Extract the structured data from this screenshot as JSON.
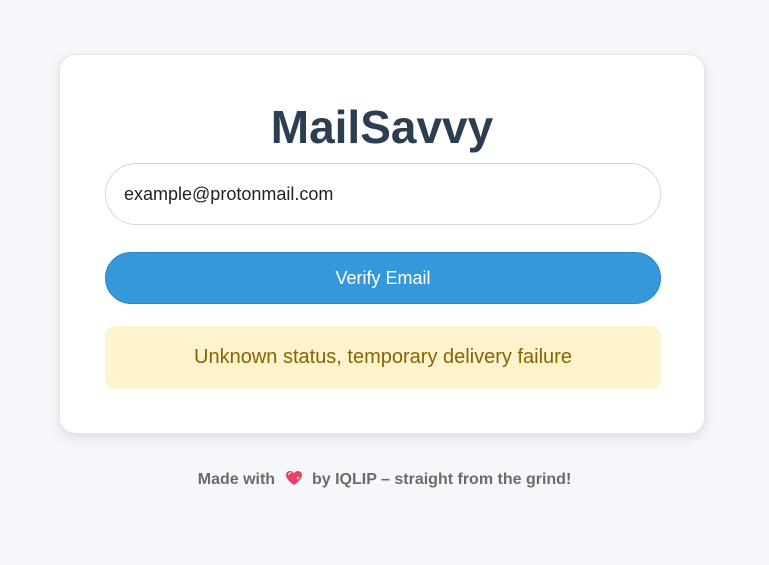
{
  "app": {
    "title": "MailSavvy"
  },
  "form": {
    "email_value": "example@protonmail.com",
    "verify_button_label": "Verify Email"
  },
  "status": {
    "message": "Unknown status, temporary delivery failure",
    "type": "warning",
    "background_color": "#fff3cd",
    "text_color": "#856404"
  },
  "footer": {
    "made_with": "Made with",
    "heart_icon": "sparkling-heart-icon",
    "by_text": "by IQLIP – straight from the grind!"
  },
  "colors": {
    "accent": "#3498db",
    "title": "#2c3e50",
    "page_background": "#f6f7fb"
  }
}
